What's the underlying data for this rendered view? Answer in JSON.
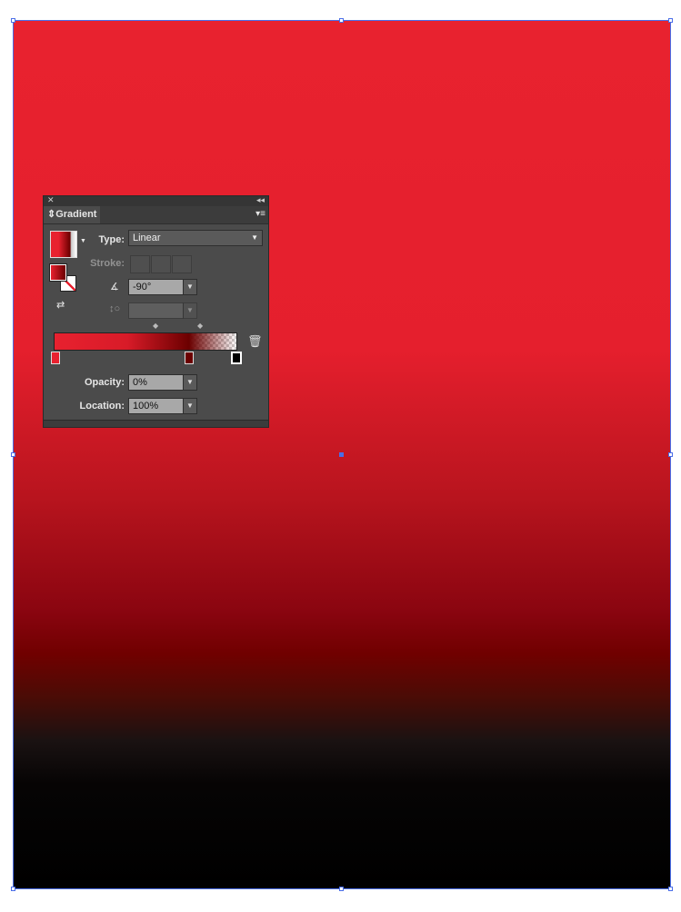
{
  "panel": {
    "title": "Gradient",
    "type_label": "Type:",
    "type_value": "Linear",
    "stroke_label": "Stroke:",
    "angle_value": "-90°",
    "aspect_value": "",
    "opacity_label": "Opacity:",
    "opacity_value": "0%",
    "location_label": "Location:",
    "location_value": "100%"
  },
  "gradient": {
    "type": "linear",
    "angle": -90,
    "stops": [
      {
        "color": "#e8212f",
        "location": 0
      },
      {
        "color": "#6b0000",
        "location": 74
      },
      {
        "color": "#000000",
        "location": 100,
        "opacity": 0
      }
    ]
  },
  "icons": [
    "close-icon",
    "collapse-icon",
    "panel-menu-icon",
    "angle-icon",
    "aspect-ratio-icon",
    "trash-icon",
    "reverse-gradient-icon"
  ]
}
